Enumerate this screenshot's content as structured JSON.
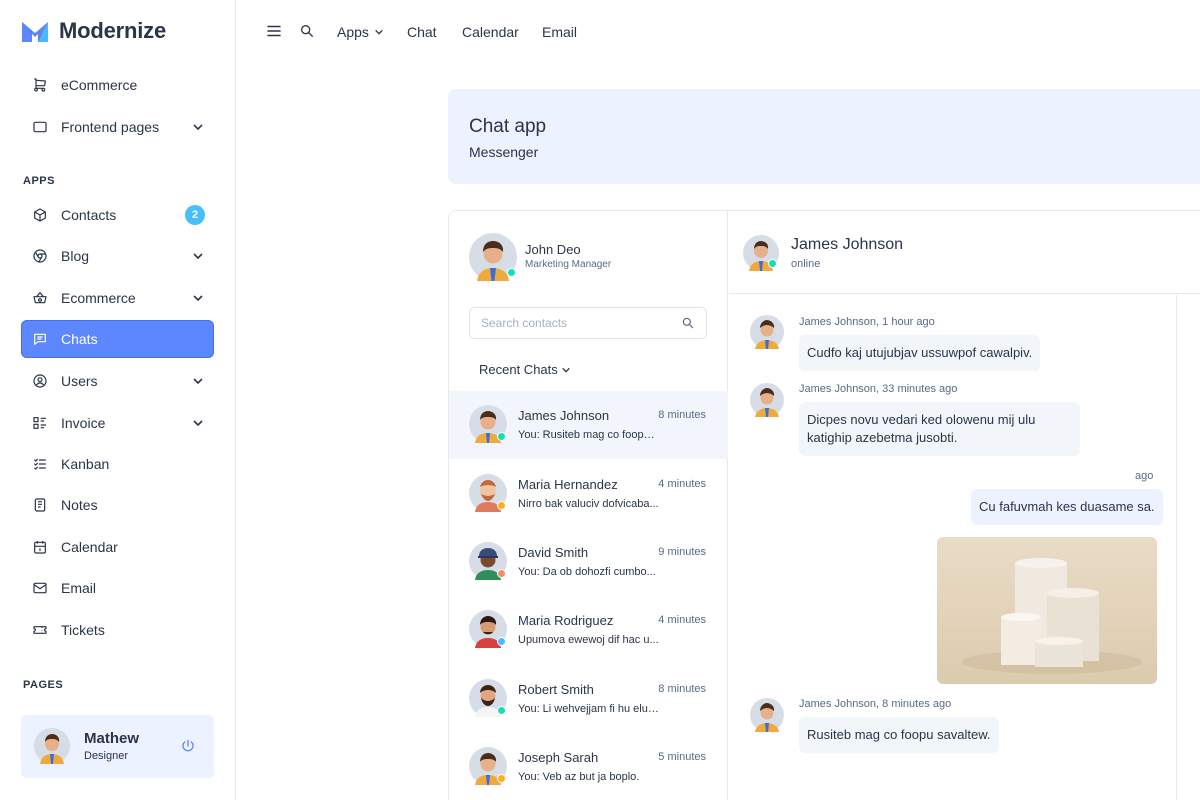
{
  "brand": {
    "name": "Modernize"
  },
  "sidebar": {
    "top_items": [
      {
        "label": "eCommerce",
        "icon": "cart-icon"
      },
      {
        "label": "Frontend pages",
        "icon": "layout-icon",
        "has_chevron": true
      }
    ],
    "apps_title": "APPS",
    "items": [
      {
        "label": "Contacts",
        "icon": "box-icon",
        "badge": "2"
      },
      {
        "label": "Blog",
        "icon": "chrome-icon",
        "has_chevron": true
      },
      {
        "label": "Ecommerce",
        "icon": "basket-icon",
        "has_chevron": true
      },
      {
        "label": "Chats",
        "icon": "message-icon",
        "active": true
      },
      {
        "label": "Users",
        "icon": "user-circle-icon",
        "has_chevron": true
      },
      {
        "label": "Invoice",
        "icon": "list-details-icon",
        "has_chevron": true
      },
      {
        "label": "Kanban",
        "icon": "list-check-icon"
      },
      {
        "label": "Notes",
        "icon": "notes-icon"
      },
      {
        "label": "Calendar",
        "icon": "calendar-icon"
      },
      {
        "label": "Email",
        "icon": "mail-icon"
      },
      {
        "label": "Tickets",
        "icon": "ticket-icon"
      }
    ],
    "pages_title": "PAGES",
    "profile": {
      "name": "Mathew",
      "role": "Designer"
    }
  },
  "topbar": {
    "links": [
      "Apps",
      "Chat",
      "Calendar",
      "Email"
    ]
  },
  "banner": {
    "title": "Chat app",
    "subtitle": "Messenger"
  },
  "chat": {
    "me": {
      "name": "John Deo",
      "role": "Marketing Manager"
    },
    "search_placeholder": "Search contacts",
    "recent_label": "Recent Chats",
    "contacts": [
      {
        "name": "James Johnson",
        "message": "You: Rusiteb mag co foopu savaltew.",
        "time": "8 minutes",
        "status_color": "#13deb9",
        "selected": true
      },
      {
        "name": "Maria Hernandez",
        "message": "Nirro bak valuciv dofvicaba...",
        "time": "4 minutes",
        "status_color": "#ffae1f"
      },
      {
        "name": "David Smith",
        "message": "You: Da ob dohozfi cumbo...",
        "time": "9 minutes",
        "status_color": "#fa896b"
      },
      {
        "name": "Maria Rodriguez",
        "message": "Upumova ewewoj dif hac u...",
        "time": "4 minutes",
        "status_color": "#49beff"
      },
      {
        "name": "Robert Smith",
        "message": "You: Li wehvejjam fi hu elula...",
        "time": "8 minutes",
        "status_color": "#13deb9"
      },
      {
        "name": "Joseph Sarah",
        "message": "You: Veb az but ja boplo.",
        "time": "5 minutes",
        "status_color": "#ffae1f"
      }
    ],
    "active": {
      "name": "James Johnson",
      "status": "online"
    },
    "messages": [
      {
        "meta": "James Johnson, 1 hour ago",
        "text": "Cudfo kaj utujubjav ussuwpof cawalpiv."
      },
      {
        "meta": "James Johnson, 33 minutes ago",
        "text": "Dicpes novu vedari ked olowenu mij ulu katighip azebetma jusobti."
      },
      {
        "meta": "ago",
        "text": "Cu fafuvmah kes duasame sa.",
        "mine": true
      },
      {
        "meta": "James Johnson, 8 minutes ago",
        "text": "Rusiteb mag co foopu savaltew."
      }
    ]
  },
  "colors": {
    "primary": "#5d87ff",
    "light_primary": "#ecf2ff",
    "badge": "#49beff",
    "online": "#13deb9"
  }
}
